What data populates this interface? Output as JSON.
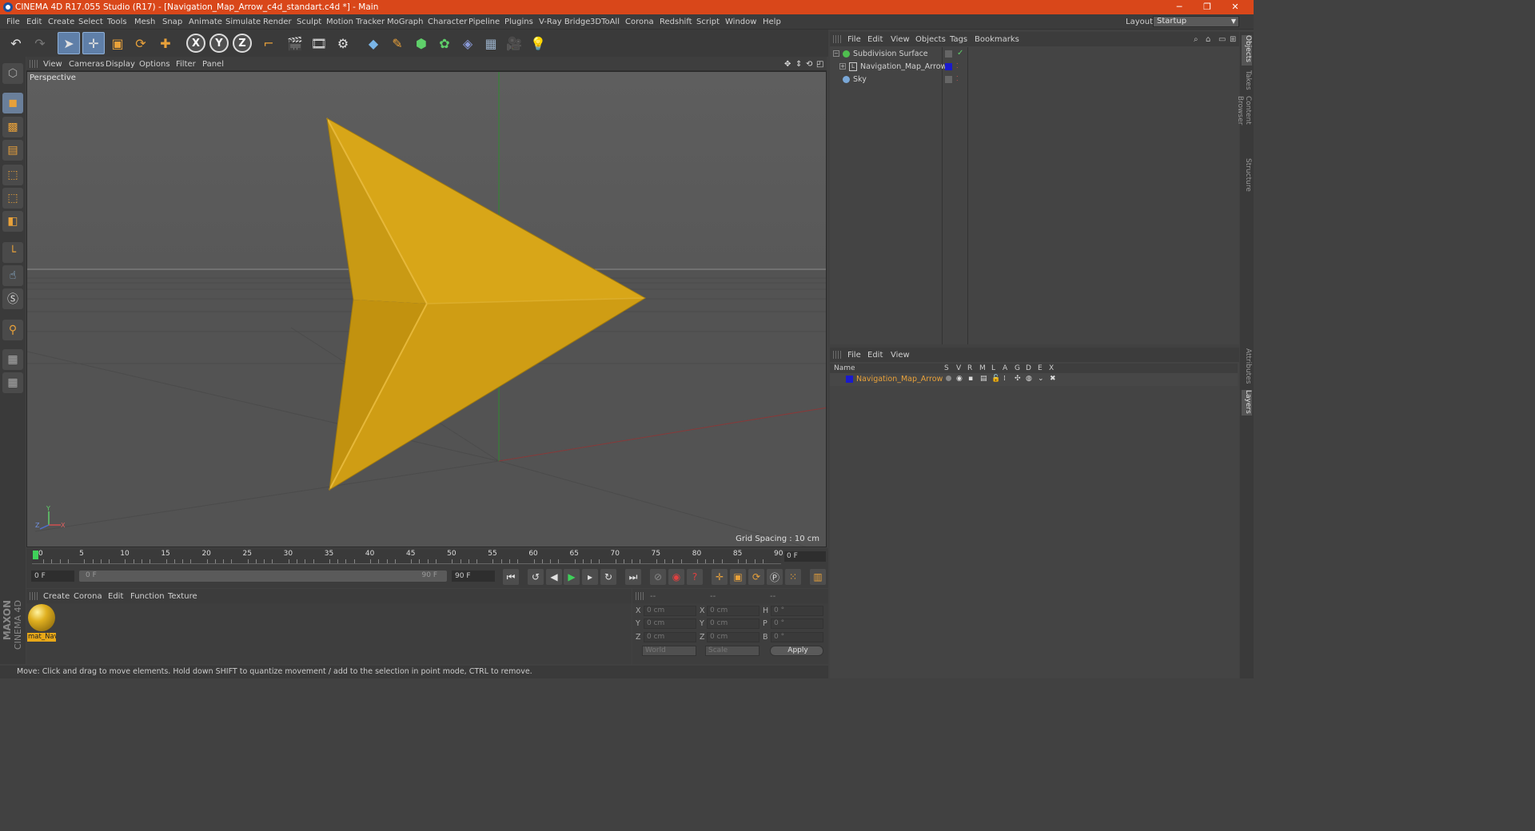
{
  "title_bar": {
    "text": "CINEMA 4D R17.055 Studio (R17) - [Navigation_Map_Arrow_c4d_standart.c4d *] - Main",
    "minimize": "─",
    "restore": "❐",
    "close": "✕"
  },
  "menu": [
    "File",
    "Edit",
    "Create",
    "Select",
    "Tools",
    "Mesh",
    "Snap",
    "Animate",
    "Simulate",
    "Render",
    "Sculpt",
    "Motion Tracker",
    "MoGraph",
    "Character",
    "Pipeline",
    "Plugins",
    "V-Ray Bridge",
    "3DToAll",
    "Corona",
    "Redshift",
    "Script",
    "Window",
    "Help"
  ],
  "layout": {
    "label": "Layout:",
    "value": "Startup"
  },
  "viewport": {
    "menu": [
      "View",
      "Cameras",
      "Display",
      "Options",
      "Filter",
      "Panel"
    ],
    "label": "Perspective",
    "grid_spacing": "Grid Spacing : 10 cm",
    "axis_y": "Y",
    "axis_z": "Z",
    "axis_x": "X"
  },
  "timeline": {
    "ticks": [
      "0",
      "5",
      "10",
      "15",
      "20",
      "25",
      "30",
      "35",
      "40",
      "45",
      "50",
      "55",
      "60",
      "65",
      "70",
      "75",
      "80",
      "85",
      "90"
    ],
    "current_frame": "0 F",
    "start": "0 F",
    "range_start": "0 F",
    "range_end": "90 F",
    "end": "90 F"
  },
  "material_manager": {
    "menu": [
      "Create",
      "Corona",
      "Edit",
      "Function",
      "Texture"
    ],
    "material_name": "mat_Nav"
  },
  "coordinates": {
    "headers": [
      "--",
      "--",
      "--"
    ],
    "rows": [
      {
        "a": "X",
        "av": "0 cm",
        "b": "X",
        "bv": "0 cm",
        "c": "H",
        "cv": "0 °"
      },
      {
        "a": "Y",
        "av": "0 cm",
        "b": "Y",
        "bv": "0 cm",
        "c": "P",
        "cv": "0 °"
      },
      {
        "a": "Z",
        "av": "0 cm",
        "b": "Z",
        "bv": "0 cm",
        "c": "B",
        "cv": "0 °"
      }
    ],
    "mode": "World",
    "scale": "Scale",
    "apply": "Apply"
  },
  "object_manager": {
    "menu": [
      "File",
      "Edit",
      "View",
      "Objects",
      "Tags",
      "Bookmarks"
    ],
    "objects": [
      {
        "name": "Subdivision Surface",
        "color": "#4fbf4f"
      },
      {
        "name": "Navigation_Map_Arrow",
        "color": "#1a1acc"
      },
      {
        "name": "Sky",
        "color": "#7aa8d8"
      }
    ]
  },
  "layer_manager": {
    "menu": [
      "File",
      "Edit",
      "View"
    ],
    "columns": [
      "Name",
      "S",
      "V",
      "R",
      "M",
      "L",
      "A",
      "G",
      "D",
      "E",
      "X"
    ],
    "layers": [
      {
        "name": "Navigation_Map_Arrow",
        "color": "#1a1acc"
      }
    ]
  },
  "side_tabs": [
    "Objects",
    "Takes",
    "Content Browser",
    "Structure",
    "Attributes",
    "Layers"
  ],
  "status": "Move: Click and drag to move elements. Hold down SHIFT to quantize movement / add to the selection in point mode, CTRL to remove.",
  "branding": {
    "maxon": "MAXON",
    "cinema": "CINEMA 4D"
  },
  "colors": {
    "title_bar": "#d9471a",
    "arrow": "#d8a618",
    "selected_tool": "#5f7fa8",
    "layer_name": "#e8a13a"
  }
}
